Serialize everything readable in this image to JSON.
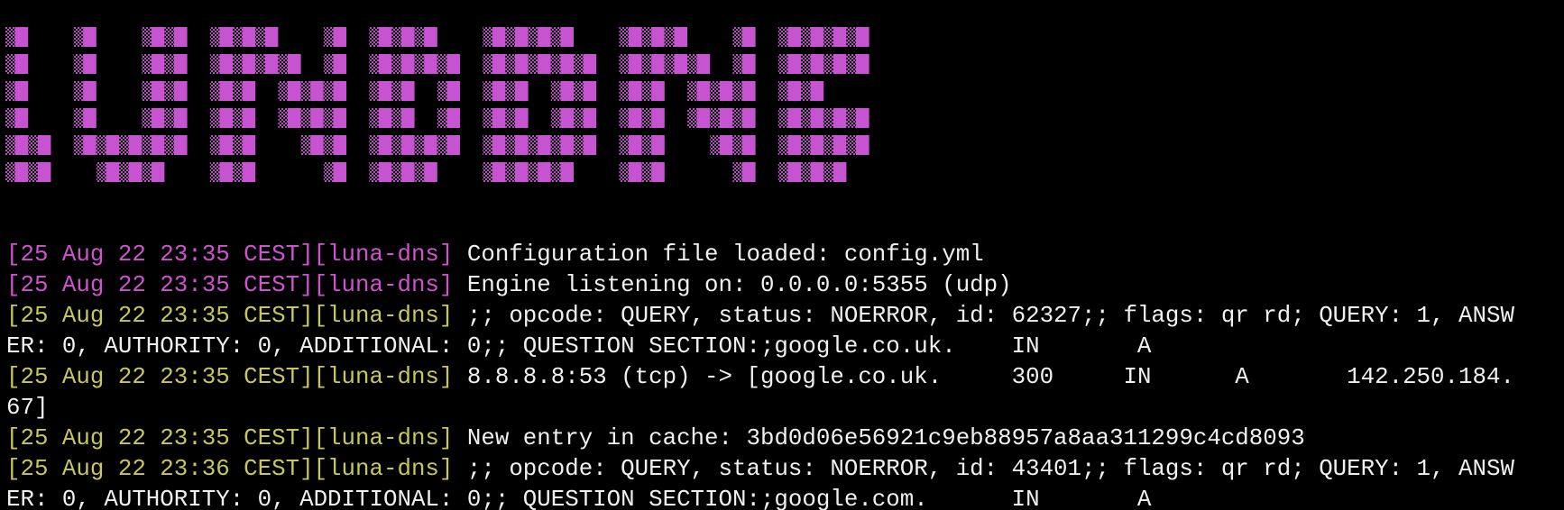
{
  "terminal": {
    "banner": {
      "art_name": "luna-dns-ascii-banner",
      "colors": {
        "solid": "#c653cf",
        "shade": "#8c3f93",
        "background": "#000000"
      },
      "rows": [
        "S  S  SS SSS  S SSS  SSSS  SSS  S SSSS",
        "S  S  SS SSSS S SSSS SSSSS SSSS S SSSS",
        "S  S  SS SS SSS SS S SS SS SS SSS SS  ",
        "S  S  SS SS SSS SS S SS SS SS SSS SSSS",
        "SS SSSSS SS  SS SSSS SSSSS SS  SS SSSS",
        "SS  SSS  SS   S SSS  SSSS  SS   S SSS "
      ]
    },
    "lines": [
      {
        "prefix": "[25 Aug 22 23:35 CEST][luna-dns]",
        "prefix_color": "magenta",
        "text": " Configuration file loaded: config.yml"
      },
      {
        "prefix": "[25 Aug 22 23:35 CEST][luna-dns]",
        "prefix_color": "magenta",
        "text": " Engine listening on: 0.0.0.0:5355 (udp)"
      },
      {
        "prefix": "[25 Aug 22 23:35 CEST][luna-dns]",
        "prefix_color": "yellow",
        "text": " ;; opcode: QUERY, status: NOERROR, id: 62327;; flags: qr rd; QUERY: 1, ANSW"
      },
      {
        "prefix": "",
        "prefix_color": "none",
        "text": "ER: 0, AUTHORITY: 0, ADDITIONAL: 0;; QUESTION SECTION:;google.co.uk.    IN       A"
      },
      {
        "prefix": "[25 Aug 22 23:35 CEST][luna-dns]",
        "prefix_color": "yellow",
        "text": " 8.8.8.8:53 (tcp) -> [google.co.uk.     300     IN      A       142.250.184."
      },
      {
        "prefix": "",
        "prefix_color": "none",
        "text": "67]"
      },
      {
        "prefix": "[25 Aug 22 23:35 CEST][luna-dns]",
        "prefix_color": "yellow",
        "text": " New entry in cache: 3bd0d06e56921c9eb88957a8aa311299c4cd8093"
      },
      {
        "prefix": "[25 Aug 22 23:36 CEST][luna-dns]",
        "prefix_color": "yellow",
        "text": " ;; opcode: QUERY, status: NOERROR, id: 43401;; flags: qr rd; QUERY: 1, ANSW"
      },
      {
        "prefix": "",
        "prefix_color": "none",
        "text": "ER: 0, AUTHORITY: 0, ADDITIONAL: 0;; QUESTION SECTION:;google.com.      IN       A"
      }
    ]
  }
}
